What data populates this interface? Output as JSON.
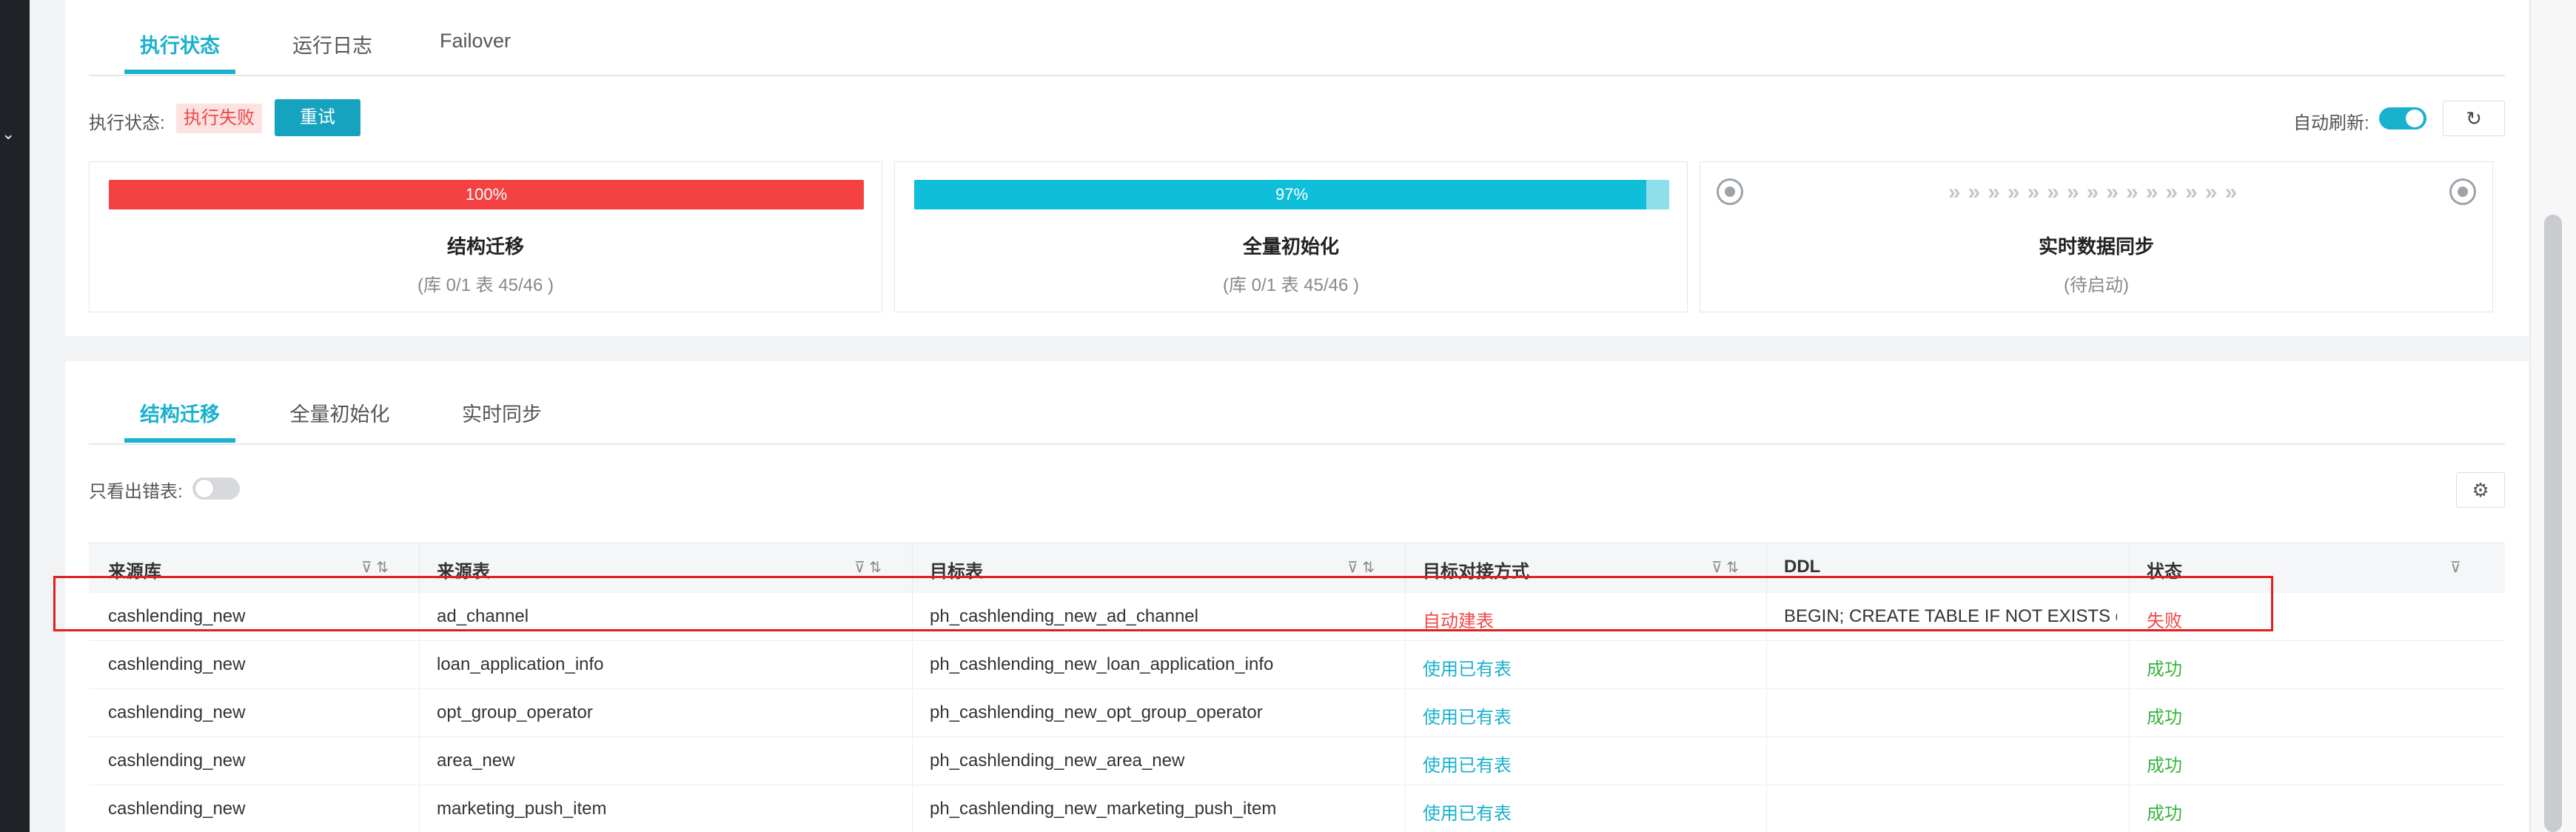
{
  "top_tabs": [
    "执行状态",
    "运行日志",
    "Failover"
  ],
  "status": {
    "label": "执行状态:",
    "badge": "执行失败",
    "retry_label": "重试",
    "auto_refresh_label": "自动刷新:",
    "auto_refresh_on": true,
    "refresh_icon": "refresh-icon"
  },
  "panels": [
    {
      "percent": 1.0,
      "percent_label": "100%",
      "title": "结构迁移",
      "sub": "(库 0/1 表 45/46 )",
      "color": "#f44242"
    },
    {
      "percent": 0.97,
      "percent_label": "97%",
      "title": "全量初始化",
      "sub": "(库 0/1 表 45/46 )",
      "color": "#0fbfd9"
    },
    {
      "title": "实时数据同步",
      "sub": "(待启动)",
      "arrows": "»»»»»»»»»»»»»»»"
    }
  ],
  "bottom_tabs": [
    "结构迁移",
    "全量初始化",
    "实时同步"
  ],
  "filter_label": "只看出错表:",
  "filter_on": false,
  "table": {
    "headers": [
      "来源库",
      "来源表",
      "目标表",
      "目标对接方式",
      "DDL",
      "状态"
    ],
    "rows": [
      [
        "cashlending_new",
        "ad_channel",
        "ph_cashlending_new_ad_channel",
        "自动建表",
        "BEGIN; CREATE TABLE IF NOT EXISTS q...",
        "失败"
      ],
      [
        "cashlending_new",
        "loan_application_info",
        "ph_cashlending_new_loan_application_info",
        "使用已有表",
        "",
        "成功"
      ],
      [
        "cashlending_new",
        "opt_group_operator",
        "ph_cashlending_new_opt_group_operator",
        "使用已有表",
        "",
        "成功"
      ],
      [
        "cashlending_new",
        "area_new",
        "ph_cashlending_new_area_new",
        "使用已有表",
        "",
        "成功"
      ],
      [
        "cashlending_new",
        "marketing_push_item",
        "ph_cashlending_new_marketing_push_item",
        "使用已有表",
        "",
        "成功"
      ]
    ]
  },
  "colors": {
    "accent": "#1ab1ce",
    "fail": "#f04848",
    "success": "#3bb33b"
  }
}
